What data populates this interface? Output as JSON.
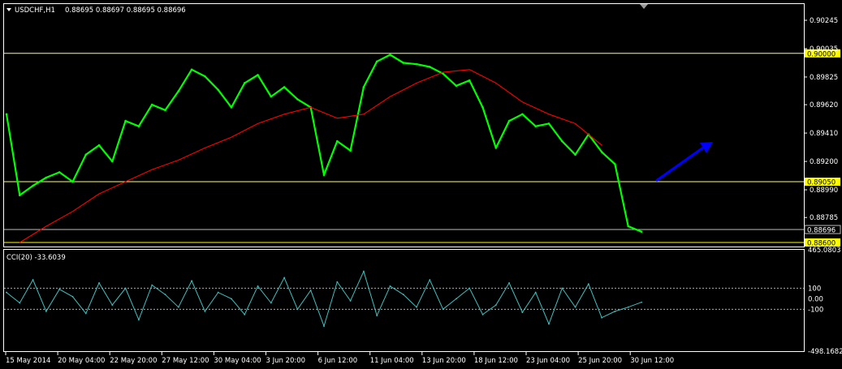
{
  "chart_data": [
    {
      "type": "line",
      "title": "USDCHF,H1",
      "quote_text": "0.88695 0.88697 0.88695 0.88696",
      "x_ticks": [
        "15 May 2014",
        "20 May 04:00",
        "22 May 20:00",
        "27 May 12:00",
        "30 May 04:00",
        "3 Jun 20:00",
        "6 Jun 12:00",
        "11 Jun 04:00",
        "13 Jun 20:00",
        "18 Jun 12:00",
        "23 Jun 04:00",
        "25 Jun 20:00",
        "30 Jun 12:00"
      ],
      "y_ticks": [
        "0.90245",
        "0.90035",
        "0.89825",
        "0.89620",
        "0.89410",
        "0.89200",
        "0.88990",
        "0.88785"
      ],
      "ylim": [
        0.8857,
        0.90365
      ],
      "grid": false,
      "series": [
        {
          "color": "#00ff00",
          "x": [
            0,
            1,
            2,
            3,
            4,
            5,
            6,
            7,
            8,
            9,
            10,
            11,
            12,
            13,
            14,
            15,
            16,
            17,
            18,
            19,
            20,
            21,
            22,
            23,
            24,
            25,
            26,
            27,
            28,
            29,
            30,
            31,
            32,
            33,
            34,
            35,
            36,
            37,
            38,
            39,
            40,
            41,
            42,
            43,
            44,
            45,
            46,
            47,
            48
          ],
          "values": [
            0.8955,
            0.8895,
            0.8902,
            0.8908,
            0.8912,
            0.8905,
            0.8925,
            0.8932,
            0.892,
            0.895,
            0.8946,
            0.8962,
            0.8958,
            0.8972,
            0.8988,
            0.8983,
            0.8973,
            0.896,
            0.8978,
            0.8984,
            0.8968,
            0.8975,
            0.8966,
            0.896,
            0.891,
            0.8935,
            0.8928,
            0.8975,
            0.8994,
            0.8999,
            0.8993,
            0.8992,
            0.899,
            0.8985,
            0.8976,
            0.898,
            0.896,
            0.893,
            0.895,
            0.8955,
            0.8946,
            0.8948,
            0.8935,
            0.8925,
            0.894,
            0.8927,
            0.8918,
            0.8872,
            0.8868
          ]
        },
        {
          "color": "#ff0000",
          "x": [
            1,
            3,
            5,
            7,
            9,
            11,
            13,
            15,
            17,
            19,
            21,
            23,
            25,
            27,
            29,
            31,
            33,
            35,
            37,
            39,
            41,
            43,
            45
          ],
          "values": [
            0.886,
            0.8872,
            0.8883,
            0.8896,
            0.8905,
            0.8914,
            0.8921,
            0.893,
            0.8938,
            0.8948,
            0.8955,
            0.896,
            0.8952,
            0.8955,
            0.8968,
            0.8978,
            0.8986,
            0.8988,
            0.8978,
            0.8964,
            0.8955,
            0.8948,
            0.8932
          ]
        }
      ],
      "horizontal_lines": [
        {
          "value": 0.9,
          "label": "0.90000",
          "color": "#ffff66"
        },
        {
          "value": 0.8905,
          "label": "0.89050",
          "color": "#ffff66"
        },
        {
          "value": 0.88696,
          "label": "0.88696",
          "color": "#bbbbbb"
        },
        {
          "value": 0.886,
          "label": "0.88600",
          "color": "#ffff00"
        }
      ],
      "arrow": {
        "color": "#0000ff",
        "direction": "up-right"
      }
    },
    {
      "type": "line",
      "title": "CCI(20) -33.6039",
      "y_ticks": [
        "465.0803",
        "100",
        "0.00",
        "-100",
        "-498.1682"
      ],
      "ylim": [
        -498.1682,
        465.0803
      ],
      "levels": [
        100,
        -100
      ],
      "series": [
        {
          "color": "#40c0c0",
          "values": [
            60,
            -40,
            180,
            -120,
            90,
            20,
            -140,
            150,
            -60,
            100,
            -200,
            130,
            40,
            -80,
            170,
            -120,
            60,
            0,
            -150,
            120,
            -40,
            200,
            -100,
            80,
            -260,
            160,
            -20,
            260,
            -160,
            120,
            40,
            -80,
            180,
            -100,
            0,
            100,
            -150,
            -60,
            150,
            -130,
            60,
            -240,
            100,
            -80,
            140,
            -180,
            -120,
            -80,
            -33.6039
          ]
        }
      ]
    }
  ]
}
